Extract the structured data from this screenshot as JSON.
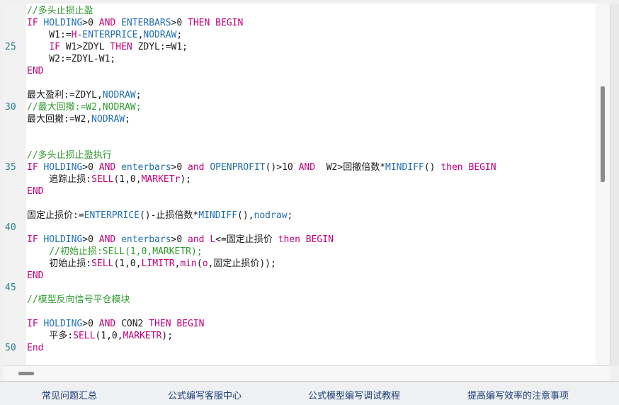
{
  "editor": {
    "line_numbers": [
      "25",
      "30",
      "35",
      "40",
      "45",
      "50"
    ],
    "lines": [
      [
        {
          "t": "//多头止损止盈",
          "c": "cm"
        }
      ],
      [
        {
          "t": "IF ",
          "c": "kw"
        },
        {
          "t": "HOLDING",
          "c": "fn"
        },
        {
          "t": ">0 ",
          "c": "tx"
        },
        {
          "t": "AND ",
          "c": "kw"
        },
        {
          "t": "ENTERBARS",
          "c": "fn"
        },
        {
          "t": ">0 ",
          "c": "tx"
        },
        {
          "t": "THEN BEGIN",
          "c": "kw"
        }
      ],
      [
        {
          "t": "    W1:=",
          "c": "tx"
        },
        {
          "t": "H",
          "c": "kw"
        },
        {
          "t": "-",
          "c": "tx"
        },
        {
          "t": "ENTERPRICE",
          "c": "fn"
        },
        {
          "t": ",",
          "c": "tx"
        },
        {
          "t": "NODRAW",
          "c": "fn"
        },
        {
          "t": ";",
          "c": "tx"
        }
      ],
      [
        {
          "t": "    ",
          "c": "tx"
        },
        {
          "t": "IF ",
          "c": "kw"
        },
        {
          "t": "W1>ZDYL ",
          "c": "tx"
        },
        {
          "t": "THEN ",
          "c": "kw"
        },
        {
          "t": "ZDYL:=W1;",
          "c": "tx"
        }
      ],
      [
        {
          "t": "    W2:=ZDYL-W1;",
          "c": "tx"
        }
      ],
      [
        {
          "t": "END",
          "c": "kw"
        }
      ],
      [],
      [
        {
          "t": "最大盈利:=ZDYL,",
          "c": "tx"
        },
        {
          "t": "NODRAW",
          "c": "fn"
        },
        {
          "t": ";",
          "c": "tx"
        }
      ],
      [
        {
          "t": "//最大回撤:=W2,NODRAW;",
          "c": "cm"
        }
      ],
      [
        {
          "t": "最大回撤:=W2,",
          "c": "tx"
        },
        {
          "t": "NODRAW",
          "c": "fn"
        },
        {
          "t": ";",
          "c": "tx"
        }
      ],
      [],
      [],
      [
        {
          "t": "//多头止损止盈执行",
          "c": "cm"
        }
      ],
      [
        {
          "t": "IF ",
          "c": "kw"
        },
        {
          "t": "HOLDING",
          "c": "fn"
        },
        {
          "t": ">0 ",
          "c": "tx"
        },
        {
          "t": "AND ",
          "c": "kw"
        },
        {
          "t": "enterbars",
          "c": "fn"
        },
        {
          "t": ">0 ",
          "c": "tx"
        },
        {
          "t": "and ",
          "c": "kw"
        },
        {
          "t": "OPENPROFIT",
          "c": "fn"
        },
        {
          "t": "()>10 ",
          "c": "tx"
        },
        {
          "t": "AND",
          "c": "kw"
        },
        {
          "t": "  W2>回撤倍数*",
          "c": "tx"
        },
        {
          "t": "MINDIFF",
          "c": "fn"
        },
        {
          "t": "() ",
          "c": "tx"
        },
        {
          "t": "then BEGIN",
          "c": "kw"
        }
      ],
      [
        {
          "t": "    追踪止损:",
          "c": "tx"
        },
        {
          "t": "SELL",
          "c": "kw"
        },
        {
          "t": "(1,0,",
          "c": "tx"
        },
        {
          "t": "MARKETr",
          "c": "kw"
        },
        {
          "t": ");",
          "c": "tx"
        }
      ],
      [
        {
          "t": "END",
          "c": "kw"
        }
      ],
      [],
      [
        {
          "t": "固定止损价:=",
          "c": "tx"
        },
        {
          "t": "ENTERPRICE",
          "c": "fn"
        },
        {
          "t": "()-止损倍数*",
          "c": "tx"
        },
        {
          "t": "MINDIFF",
          "c": "fn"
        },
        {
          "t": "(),",
          "c": "tx"
        },
        {
          "t": "nodraw",
          "c": "fn"
        },
        {
          "t": ";",
          "c": "tx"
        }
      ],
      [],
      [
        {
          "t": "IF ",
          "c": "kw"
        },
        {
          "t": "HOLDING",
          "c": "fn"
        },
        {
          "t": ">0 ",
          "c": "tx"
        },
        {
          "t": "AND ",
          "c": "kw"
        },
        {
          "t": "enterbars",
          "c": "fn"
        },
        {
          "t": ">0 ",
          "c": "tx"
        },
        {
          "t": "and ",
          "c": "kw"
        },
        {
          "t": "L",
          "c": "kw"
        },
        {
          "t": "<=固定止损价 ",
          "c": "tx"
        },
        {
          "t": "then BEGIN",
          "c": "kw"
        }
      ],
      [
        {
          "t": "    //初始止损:SELL(1,0,MARKETR);",
          "c": "cm"
        }
      ],
      [
        {
          "t": "    初始止损:",
          "c": "tx"
        },
        {
          "t": "SELL",
          "c": "kw"
        },
        {
          "t": "(1,0,",
          "c": "tx"
        },
        {
          "t": "LIMITR",
          "c": "kw"
        },
        {
          "t": ",",
          "c": "tx"
        },
        {
          "t": "min",
          "c": "kw"
        },
        {
          "t": "(",
          "c": "tx"
        },
        {
          "t": "o",
          "c": "kw"
        },
        {
          "t": ",固定止损价));",
          "c": "tx"
        }
      ],
      [
        {
          "t": "END",
          "c": "kw"
        }
      ],
      [],
      [
        {
          "t": "//模型反向信号平仓模块",
          "c": "cm"
        }
      ],
      [],
      [
        {
          "t": "IF ",
          "c": "kw"
        },
        {
          "t": "HOLDING",
          "c": "fn"
        },
        {
          "t": ">0 ",
          "c": "tx"
        },
        {
          "t": "AND ",
          "c": "kw"
        },
        {
          "t": "CON2 ",
          "c": "tx"
        },
        {
          "t": "THEN BEGIN",
          "c": "kw"
        }
      ],
      [
        {
          "t": "    平多:",
          "c": "tx"
        },
        {
          "t": "SELL",
          "c": "kw"
        },
        {
          "t": "(1,0,",
          "c": "tx"
        },
        {
          "t": "MARKETR",
          "c": "kw"
        },
        {
          "t": ");",
          "c": "tx"
        }
      ],
      [
        {
          "t": "End",
          "c": "kw"
        }
      ]
    ]
  },
  "links": [
    "常见问题汇总",
    "公式编写客服中心",
    "公式模型编写调试教程",
    "提高编写效率的注意事项"
  ]
}
